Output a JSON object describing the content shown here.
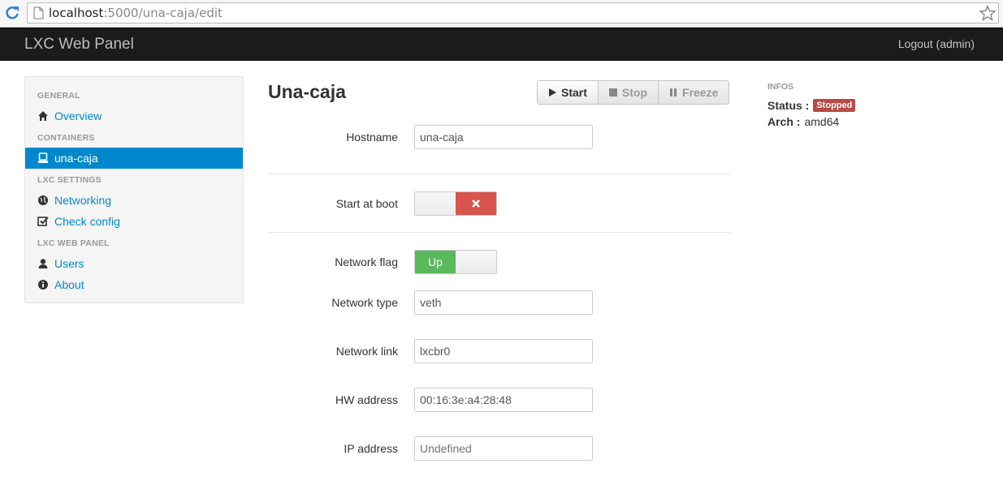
{
  "browser": {
    "url_host": "localhost",
    "url_path": ":5000/una-caja/edit"
  },
  "navbar": {
    "brand": "LXC Web Panel",
    "logout": "Logout (admin)"
  },
  "sidebar": {
    "headers": [
      "GENERAL",
      "CONTAINERS",
      "LXC SETTINGS",
      "LXC WEB PANEL"
    ],
    "items": [
      {
        "label": "Overview",
        "icon": "home-icon"
      },
      {
        "label": "una-caja",
        "icon": "container-icon",
        "active": true
      },
      {
        "label": "Networking",
        "icon": "globe-icon"
      },
      {
        "label": "Check config",
        "icon": "check-icon"
      },
      {
        "label": "Users",
        "icon": "user-icon"
      },
      {
        "label": "About",
        "icon": "info-icon"
      }
    ]
  },
  "main": {
    "title": "Una-caja",
    "actions": {
      "start": "Start",
      "stop": "Stop",
      "freeze": "Freeze"
    },
    "hostname": {
      "label": "Hostname",
      "value": "una-caja"
    },
    "start_at_boot": {
      "label": "Start at boot",
      "state": "off"
    },
    "network_flag": {
      "label": "Network flag",
      "value": "Up"
    },
    "network_type": {
      "label": "Network type",
      "value": "veth"
    },
    "network_link": {
      "label": "Network link",
      "value": "lxcbr0"
    },
    "hw_address": {
      "label": "HW address",
      "value": "00:16:3e:a4:28:48"
    },
    "ip_address": {
      "label": "IP address",
      "placeholder": "Undefined"
    }
  },
  "infos": {
    "heading": "INFOS",
    "status_key": "Status :",
    "status_value": "Stopped",
    "arch_key": "Arch :",
    "arch_value": "amd64"
  },
  "colors": {
    "navbar_bg": "#1b1b1b",
    "link": "#0088cc",
    "danger": "#d9534f",
    "success": "#5cb85c",
    "badge": "#b94a48"
  }
}
